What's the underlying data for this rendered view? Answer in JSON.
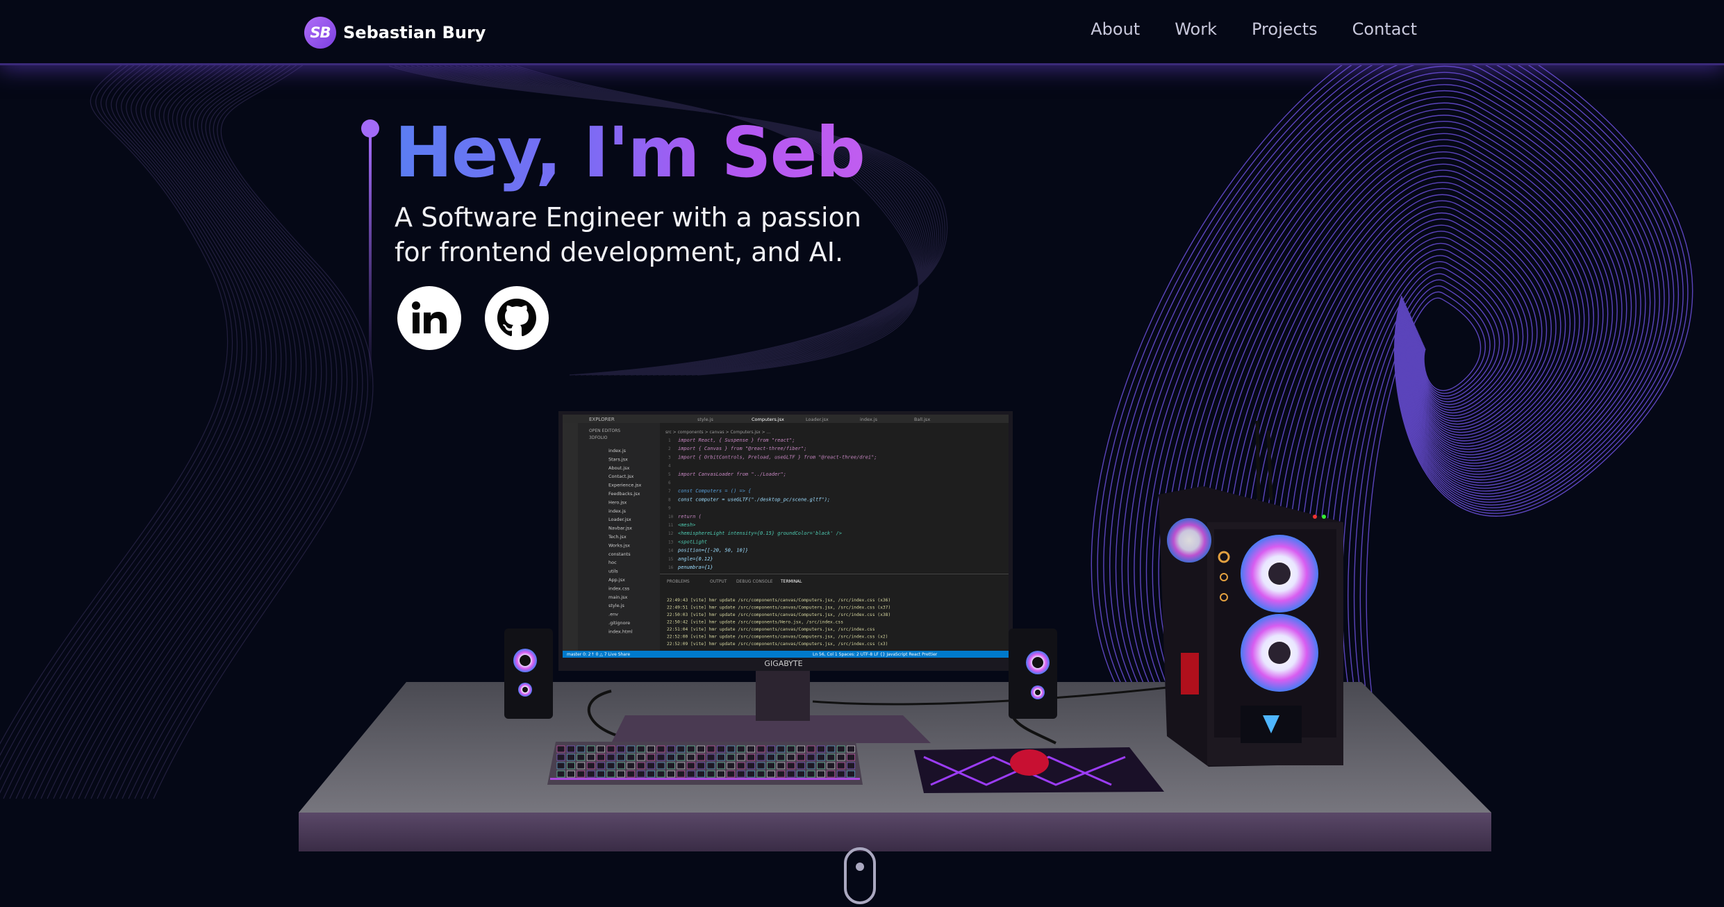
{
  "nav": {
    "logo_initials": "SB",
    "logo_name": "Sebastian Bury",
    "links": [
      "About",
      "Work",
      "Projects",
      "Contact"
    ]
  },
  "hero": {
    "title": "Hey, I'm Seb",
    "subtitle_line1": "A Software Engineer with a passion",
    "subtitle_line2": "for frontend development, and AI."
  },
  "social": {
    "linkedin_icon": "linkedin-icon",
    "github_icon": "github-icon"
  },
  "monitor": {
    "brand": "GIGABYTE",
    "editor": {
      "sidebar_title": "EXPLORER",
      "open_editors": "OPEN EDITORS",
      "project": "3DFOLIO",
      "tabs": [
        "style.js",
        "Computers.jsx",
        "Loader.jsx",
        "index.js",
        "Ball.jsx"
      ],
      "breadcrumb": "src > components > canvas > Computers.jsx > ...",
      "files": [
        "index.js",
        "Stars.jsx",
        "About.jsx",
        "Contact.jsx",
        "Experience.jsx",
        "Feedbacks.jsx",
        "Hero.jsx",
        "index.js",
        "Loader.jsx",
        "Navbar.jsx",
        "Tech.jsx",
        "Works.jsx",
        "constants",
        "hoc",
        "utils",
        "App.jsx",
        "index.css",
        "main.jsx",
        "style.js",
        ".env",
        ".gitignore",
        "index.html"
      ],
      "code": [
        "import React, { Suspense } from \"react\";",
        "import { Canvas } from \"@react-three/fiber\";",
        "import { OrbitControls, Preload, useGLTF } from \"@react-three/drei\";",
        "",
        "import CanvasLoader from \"../Loader\";",
        "",
        "const Computers = () => {",
        "  const computer = useGLTF(\"./desktop_pc/scene.gltf\");",
        "",
        "  return (",
        "    <mesh>",
        "      <hemisphereLight intensity={0.15} groundColor='black' />",
        "      <spotLight",
        "        position={[-20, 50, 10]}",
        "        angle={0.12}",
        "        penumbra={1}"
      ],
      "panel_tabs": [
        "PROBLEMS",
        "OUTPUT",
        "DEBUG CONSOLE",
        "TERMINAL"
      ],
      "terminal": [
        "22:49:43 [vite] hmr update /src/components/canvas/Computers.jsx, /src/index.css (x36)",
        "22:49:51 [vite] hmr update /src/components/canvas/Computers.jsx, /src/index.css (x37)",
        "22:50:03 [vite] hmr update /src/components/canvas/Computers.jsx, /src/index.css (x38)",
        "22:50:42 [vite] hmr update /src/components/Hero.jsx, /src/index.css",
        "22:51:04 [vite] hmr update /src/components/canvas/Computers.jsx, /src/index.css",
        "22:52:00 [vite] hmr update /src/components/canvas/Computers.jsx, /src/index.css (x2)",
        "22:52:09 [vite] hmr update /src/components/canvas/Computers.jsx, /src/index.css (x3)"
      ],
      "status_left": "master  0: 2↑  0 △ 7  Live Share",
      "status_right": "Ln 56, Col 1   Spaces: 2   UTF-8   LF   {} JavaScript React   Prettier"
    }
  },
  "colors": {
    "background": "#050816",
    "accent_purple": "#915eff",
    "title_start": "#5b7df2",
    "title_end": "#c05df0"
  },
  "scroll_indicator_icon": "mouse-scroll-icon"
}
